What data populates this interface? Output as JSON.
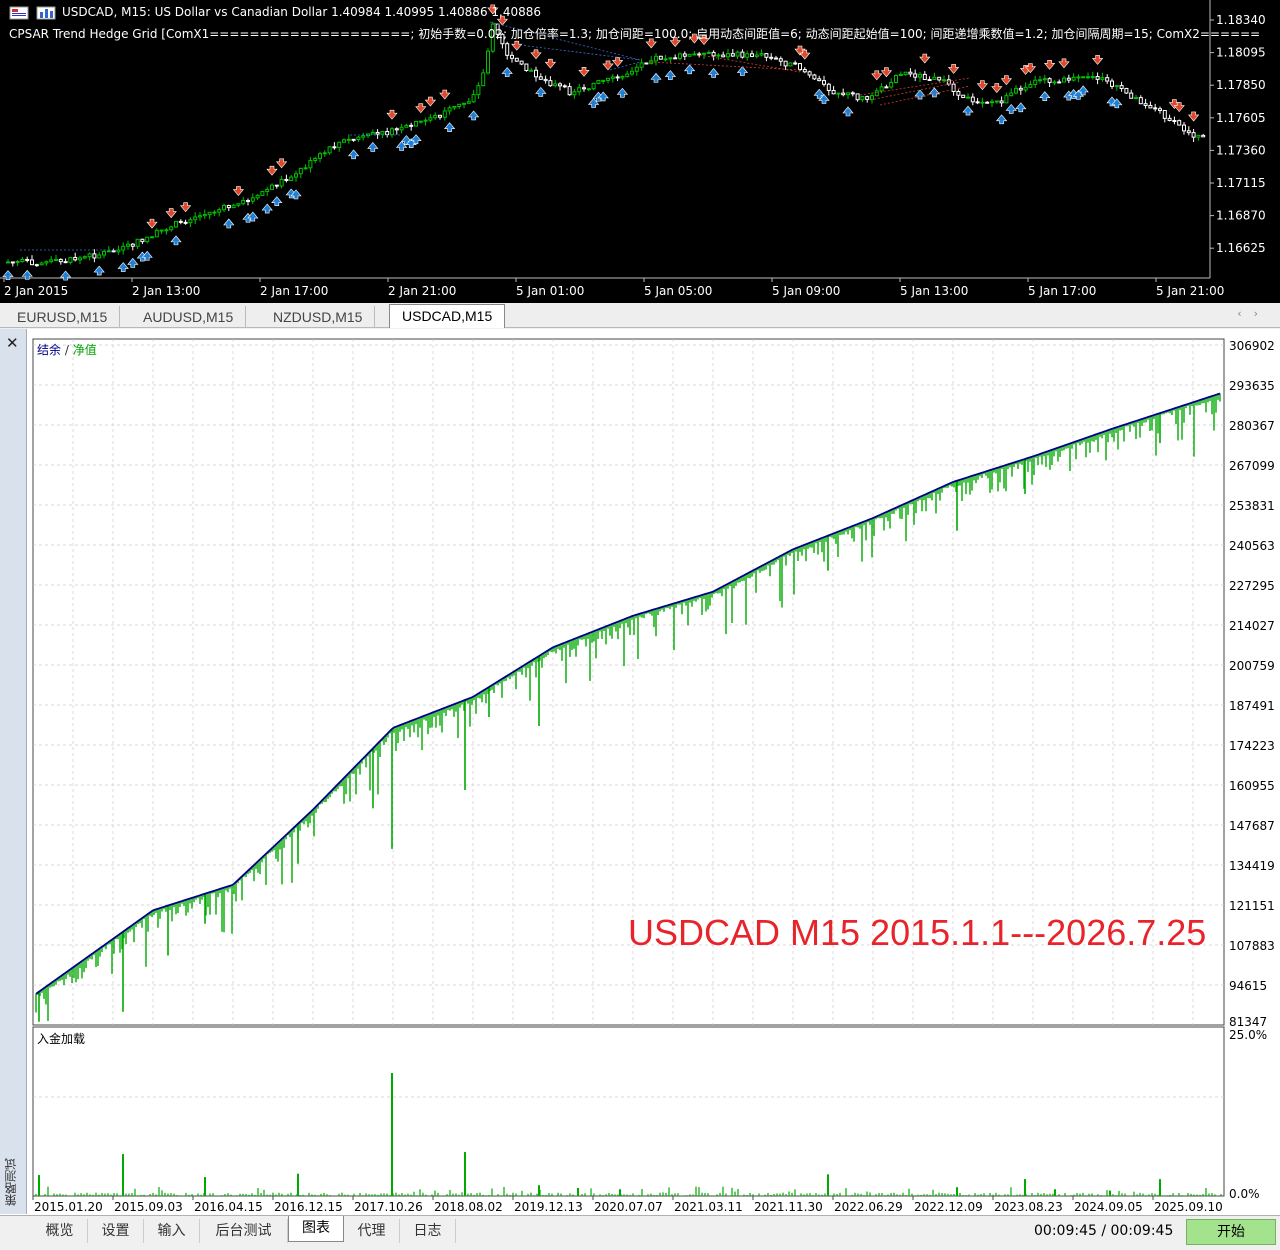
{
  "price_chart": {
    "symbol_line": "USDCAD, M15:  US Dollar vs Canadian Dollar  1.40984 1.40995 1.40886 1.40886",
    "indicator_line": "CPSAR Trend Hedge Grid [ComX1====================; 初始手数=0.02; 加仓倍率=1.3; 加仓间距=100.0; 启用动态间距值=6; 动态间距起始值=100; 间距递增乘数值=1.2; 加仓间隔周期=15; ComX2======",
    "price_labels": [
      "1.18340",
      "1.18095",
      "1.17850",
      "1.17605",
      "1.17360",
      "1.17115",
      "1.16870",
      "1.16625"
    ],
    "time_labels": [
      "2 Jan 2015",
      "2 Jan 13:00",
      "2 Jan 17:00",
      "2 Jan 21:00",
      "5 Jan 01:00",
      "5 Jan 05:00",
      "5 Jan 09:00",
      "5 Jan 13:00",
      "5 Jan 17:00",
      "5 Jan 21:00"
    ],
    "colors": {
      "bull": "#00c000",
      "bear": "#ffffff",
      "buy_arrow": "#1e7fd6",
      "sell_arrow": "#e0482a"
    }
  },
  "symbol_tabs": [
    {
      "label": "EURUSD,M15",
      "active": false
    },
    {
      "label": "AUDUSD,M15",
      "active": false
    },
    {
      "label": "NZDUSD,M15",
      "active": false
    },
    {
      "label": "USDCAD,M15",
      "active": true
    }
  ],
  "tester": {
    "side_title": "策略测试",
    "legend_balance": "结余",
    "legend_sep": " / ",
    "legend_equity": "净值",
    "deposit_label": "入金加载",
    "caption": "USDCAD M15 2015.1.1---2026.7.25",
    "y_labels": [
      "306902",
      "293635",
      "280367",
      "267099",
      "253831",
      "240563",
      "227295",
      "214027",
      "200759",
      "187491",
      "174223",
      "160955",
      "147687",
      "134419",
      "121151",
      "107883",
      "94615",
      "81347"
    ],
    "load_labels": [
      "25.0%",
      "0.0%"
    ],
    "x_labels": [
      "2015.01.20",
      "2015.09.03",
      "2016.04.15",
      "2016.12.15",
      "2017.10.26",
      "2018.08.02",
      "2019.12.13",
      "2020.07.07",
      "2021.03.11",
      "2021.11.30",
      "2022.06.29",
      "2022.12.09",
      "2023.08.23",
      "2024.09.05",
      "2025.09.10"
    ],
    "colors": {
      "balance": "#000088",
      "equity": "#00aa00",
      "caption": "#e8242b"
    }
  },
  "chart_data": {
    "type": "line",
    "title": "",
    "xlabel": "",
    "ylabel": "",
    "x": [
      "2015.01.20",
      "2015.09.03",
      "2016.04.15",
      "2016.12.15",
      "2017.10.26",
      "2018.08.02",
      "2019.12.13",
      "2020.07.07",
      "2021.03.11",
      "2021.11.30",
      "2022.06.29",
      "2022.12.09",
      "2023.08.23",
      "2024.09.05",
      "2025.09.10"
    ],
    "ylim": [
      81347,
      306902
    ],
    "series": [
      {
        "name": "结余",
        "values": [
          100500,
          119500,
          128000,
          153000,
          180200,
          190500,
          207000,
          217500,
          225500,
          239600,
          250000,
          262000,
          270500,
          279800,
          288500
        ]
      },
      {
        "name": "净值",
        "values": [
          100000,
          119000,
          127500,
          152500,
          179500,
          190000,
          206500,
          217000,
          225000,
          239000,
          249500,
          261500,
          270000,
          279300,
          288000
        ]
      }
    ],
    "deposit_load": {
      "ylim": [
        0,
        25
      ],
      "peaks": [
        {
          "x": "2015.01.20",
          "value": 3.1
        },
        {
          "x": "2015.09.03",
          "value": 6.2
        },
        {
          "x": "2016.04.15",
          "value": 2.8
        },
        {
          "x": "2016.12.15",
          "value": 3.3
        },
        {
          "x": "2017.10.26",
          "value": 18.2
        },
        {
          "x": "2018.08.02",
          "value": 6.5
        },
        {
          "x": "2019.12.13",
          "value": 1.6
        },
        {
          "x": "2020.07.07",
          "value": 1.2
        },
        {
          "x": "2021.03.11",
          "value": 1.0
        },
        {
          "x": "2021.11.30",
          "value": 3.2
        },
        {
          "x": "2022.06.29",
          "value": 1.3
        },
        {
          "x": "2022.12.09",
          "value": 2.5
        },
        {
          "x": "2023.08.23",
          "value": 1.0
        },
        {
          "x": "2024.09.05",
          "value": 0.8
        },
        {
          "x": "2025.09.10",
          "value": 2.5
        }
      ]
    }
  },
  "bottom_tabs": [
    {
      "label": "概览",
      "active": false
    },
    {
      "label": "设置",
      "active": false
    },
    {
      "label": "输入",
      "active": false
    },
    {
      "label": "后台测试",
      "active": false
    },
    {
      "label": "图表",
      "active": true
    },
    {
      "label": "代理",
      "active": false
    },
    {
      "label": "日志",
      "active": false
    }
  ],
  "time_readout": "00:09:45 / 00:09:45",
  "start_label": "开始"
}
